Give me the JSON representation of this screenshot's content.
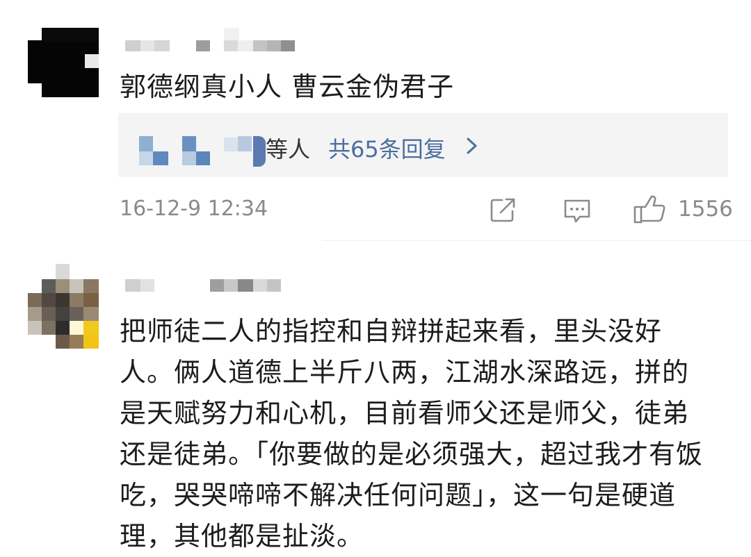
{
  "comment1": {
    "text": "郭德纲真小人  曹云金伪君子",
    "reply_by_suffix": "等人",
    "reply_count": "共65条回复",
    "chevron": "›",
    "timestamp": "16-12-9 12:34",
    "likes": "1556",
    "icons": [
      "share-icon",
      "comment-icon",
      "like-icon"
    ]
  },
  "comment2": {
    "lines": [
      "把师徒二人的指控和自辩拼起来看，里头没好",
      "人。俩人道德上半斤八两，江湖水深路远，拼的",
      "是天赋努力和心机，目前看师父还是师父，徒弟",
      "还是徒弟。「你要做的是必须强大，超过我才有饭",
      "吃，哭哭啼啼不解决任何问题」，这一句是硬道",
      "理，其他都是扯淡。"
    ]
  },
  "colors": {
    "link": "#4a6ea0",
    "meta": "#8a8a8a",
    "reply_bg": "#f4f4f4"
  }
}
